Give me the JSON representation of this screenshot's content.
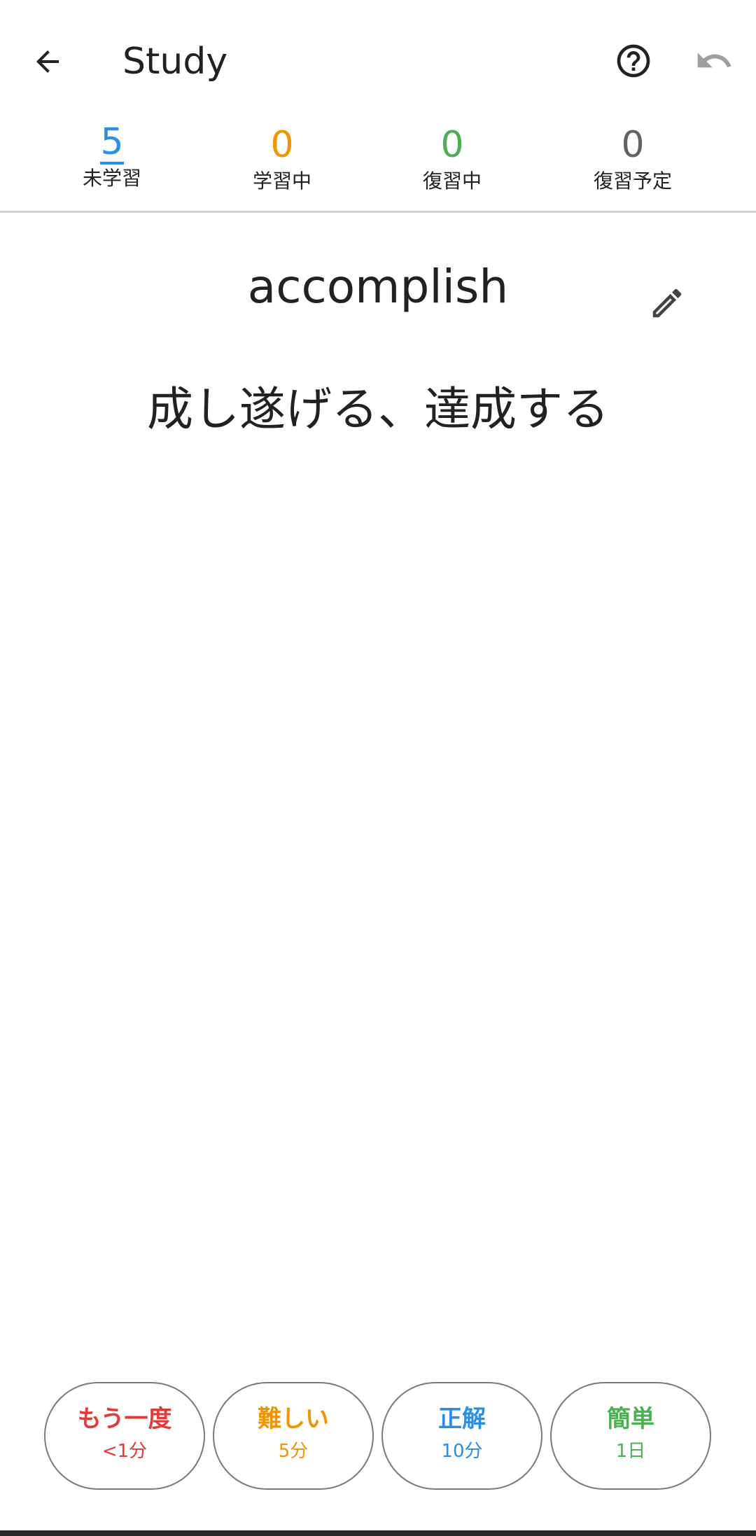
{
  "header": {
    "title": "Study",
    "back_icon": "arrow-left-icon",
    "help_icon": "help-circle-icon",
    "undo_icon": "undo-icon"
  },
  "counters": {
    "new": {
      "value": "5",
      "label": "未学習",
      "color": "#2a8ee8"
    },
    "learning": {
      "value": "0",
      "label": "学習中",
      "color": "#f29400"
    },
    "review": {
      "value": "0",
      "label": "復習中",
      "color": "#4caf50"
    },
    "scheduled": {
      "value": "0",
      "label": "復習予定",
      "color": "#5f6368"
    }
  },
  "card": {
    "word": "accomplish",
    "meaning": "成し遂げる、達成する",
    "edit_icon": "pencil-icon"
  },
  "answers": [
    {
      "label": "もう一度",
      "time": "<1分",
      "color": "#e53935"
    },
    {
      "label": "難しい",
      "time": "5分",
      "color": "#f29400"
    },
    {
      "label": "正解",
      "time": "10分",
      "color": "#2a8ee8"
    },
    {
      "label": "簡単",
      "time": "1日",
      "color": "#4caf50"
    }
  ]
}
